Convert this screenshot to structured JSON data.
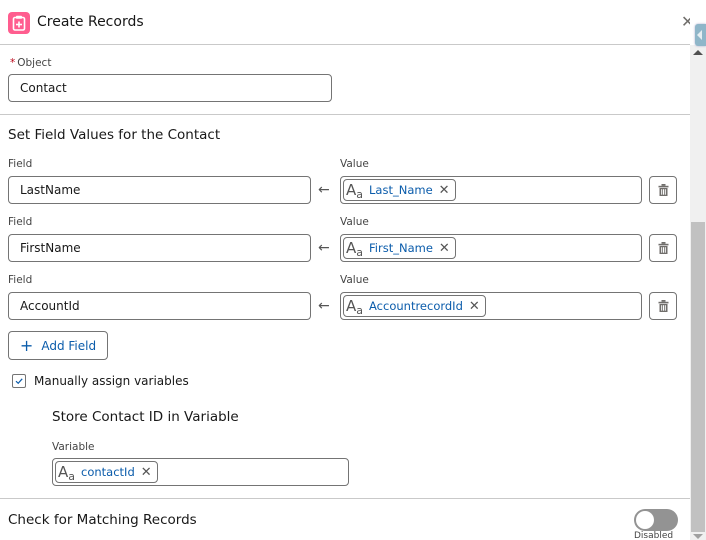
{
  "header": {
    "title": "Create Records",
    "icon": "record-create-icon",
    "close_icon": "close-icon",
    "close_glyph": "✕"
  },
  "object": {
    "required_marker": "*",
    "label": "Object",
    "value": "Contact"
  },
  "field_values_section": {
    "title": "Set Field Values for the Contact",
    "field_label": "Field",
    "value_label": "Value",
    "arrow_glyph": "←",
    "rows": [
      {
        "field": "LastName",
        "value": "Last_Name",
        "value_type_icon": "text-resource-icon"
      },
      {
        "field": "FirstName",
        "value": "First_Name",
        "value_type_icon": "text-resource-icon"
      },
      {
        "field": "AccountId",
        "value": "AccountrecordId",
        "value_type_icon": "text-resource-icon"
      }
    ],
    "remove_glyph": "✕",
    "delete_icon": "trash-icon"
  },
  "add_field": {
    "plus_glyph": "+",
    "label": "Add Field"
  },
  "manual_assign": {
    "label": "Manually assign variables",
    "checked": true
  },
  "store_id": {
    "title": "Store Contact ID in Variable",
    "variable_label": "Variable",
    "variable_value": "contactId"
  },
  "matching": {
    "title": "Check for Matching Records",
    "toggle_state": false,
    "toggle_label": "Disabled"
  },
  "pill_icon": {
    "big": "A",
    "small": "a"
  },
  "colors": {
    "accent": "#0b5cab",
    "header_icon": "#ff5d8f",
    "required": "#ba0517",
    "toggle_off": "#939393"
  }
}
